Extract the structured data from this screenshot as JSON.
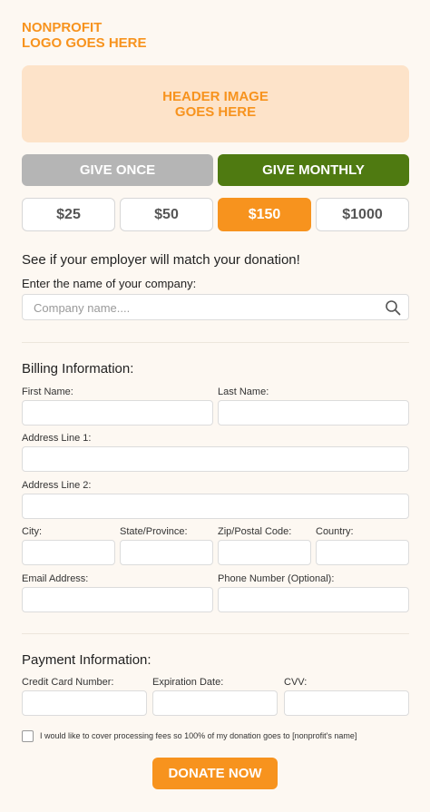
{
  "logo": {
    "text": "NONPROFIT\nLOGO GOES HERE"
  },
  "header_image": {
    "text": "HEADER IMAGE\nGOES HERE"
  },
  "frequency": {
    "once_label": "GIVE ONCE",
    "monthly_label": "GIVE MONTHLY",
    "selected": "monthly"
  },
  "amounts": {
    "options": [
      "$25",
      "$50",
      "$150",
      "$1000"
    ],
    "selected": "$150"
  },
  "employer_match": {
    "title": "See if your employer will match your donation!",
    "prompt": "Enter the name of your company:",
    "placeholder": "Company name...."
  },
  "billing": {
    "title": "Billing Information:",
    "first_name_label": "First Name:",
    "last_name_label": "Last Name:",
    "address1_label": "Address Line 1:",
    "address2_label": "Address Line 2:",
    "city_label": "City:",
    "state_label": "State/Province:",
    "zip_label": "Zip/Postal Code:",
    "country_label": "Country:",
    "email_label": "Email Address:",
    "phone_label": "Phone Number (Optional):"
  },
  "payment": {
    "title": "Payment Information:",
    "card_label": "Credit Card Number:",
    "expiry_label": "Expiration Date:",
    "cvv_label": "CVV:"
  },
  "cover_fees": {
    "label": "I would like to cover processing fees so 100% of my donation goes to [nonprofit's name]",
    "checked": false
  },
  "donate_button": {
    "label": "DONATE NOW"
  },
  "colors": {
    "accent": "#f7931e",
    "monthly_green": "#4f7a11",
    "inactive_gray": "#b5b5b5",
    "header_bg": "#fde3c9",
    "page_bg": "#fdf8f2"
  },
  "icons": {
    "search": "search-icon"
  }
}
